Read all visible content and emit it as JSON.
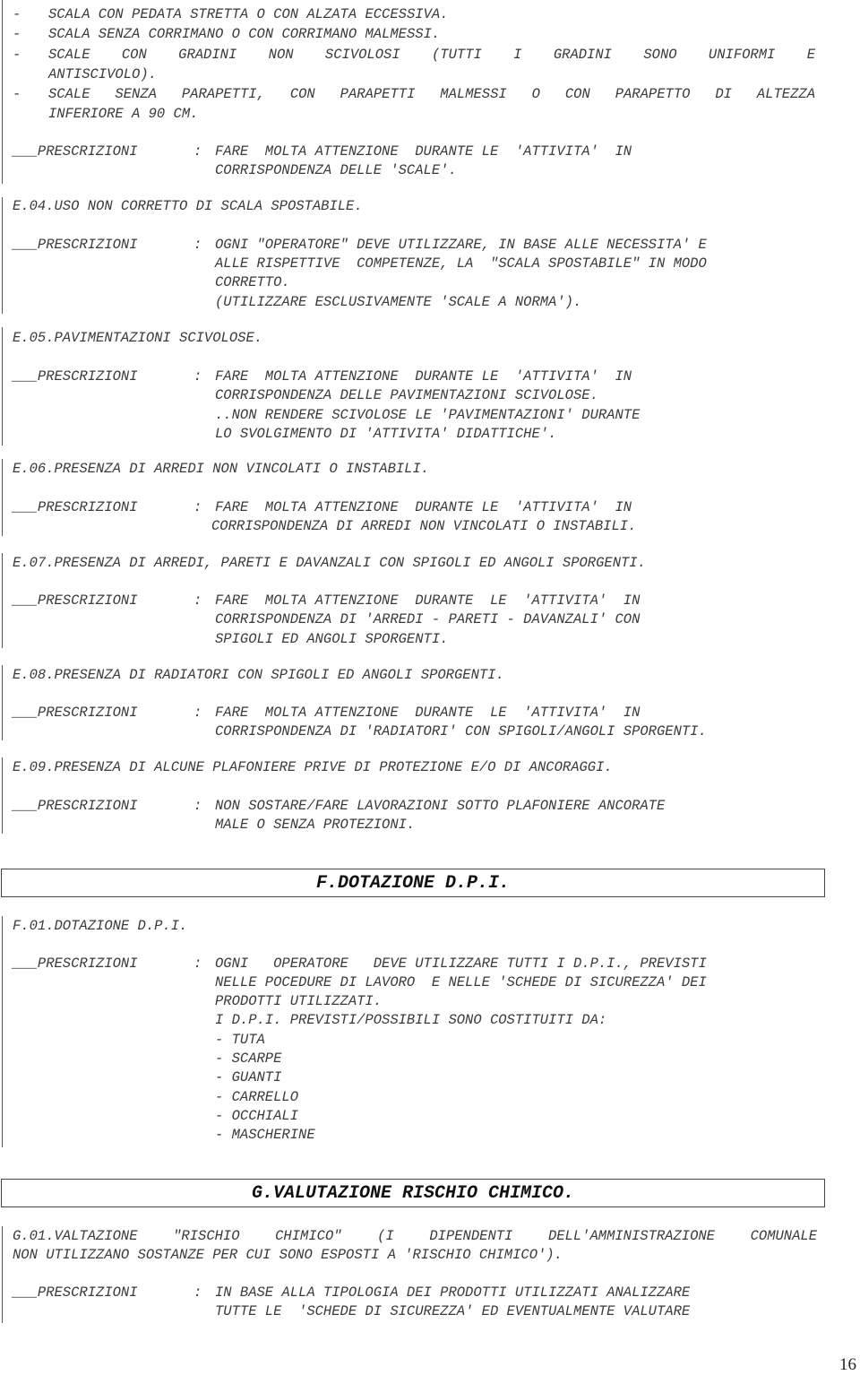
{
  "bullets_top": [
    {
      "dash": "-",
      "text": "SCALA CON PEDATA STRETTA O CON ALZATA ECCESSIVA."
    },
    {
      "dash": "-",
      "text": "SCALA SENZA CORRIMANO O CON CORRIMANO MALMESSI."
    },
    {
      "dash": "-",
      "text": "SCALE  CON  GRADINI  NON  SCIVOLOSI  (TUTTI  I  GRADINI  SONO  UNIFORMI  E",
      "cont": "ANTISCIVOLO)."
    },
    {
      "dash": "-",
      "text": "SCALE  SENZA  PARAPETTI,  CON  PARAPETTI  MALMESSI  O  CON  PARAPETTO  DI  ALTEZZA",
      "cont": "INFERIORE A 90 CM."
    }
  ],
  "presc_label": "___PRESCRIZIONI",
  "colon": ":",
  "blocks": {
    "e03_presc": [
      "FARE  MOLTA ATTENZIONE  DURANTE LE  'ATTIVITA'  IN",
      "CORRISPONDENZA DELLE 'SCALE'."
    ],
    "e04_title": "E.04.USO NON CORRETTO DI SCALA SPOSTABILE.",
    "e04_presc": [
      "OGNI \"OPERATORE\" DEVE UTILIZZARE, IN BASE ALLE NECESSITA' E",
      "ALLE RISPETTIVE  COMPETENZE, LA  \"SCALA SPOSTABILE\" IN MODO",
      "CORRETTO.",
      "(UTILIZZARE ESCLUSIVAMENTE 'SCALE A NORMA')."
    ],
    "e05_title": "E.05.PAVIMENTAZIONI SCIVOLOSE.",
    "e05_presc": [
      "FARE  MOLTA ATTENZIONE  DURANTE LE  'ATTIVITA'  IN",
      "CORRISPONDENZA DELLE PAVIMENTAZIONI SCIVOLOSE.",
      "..NON RENDERE SCIVOLOSE LE 'PAVIMENTAZIONI' DURANTE",
      "LO SVOLGIMENTO DI 'ATTIVITA' DIDATTICHE'."
    ],
    "e06_title": "E.06.PRESENZA DI ARREDI NON VINCOLATI O INSTABILI.",
    "e06_presc": [
      "FARE  MOLTA ATTENZIONE  DURANTE LE  'ATTIVITA'  IN",
      "CORRISPONDENZA DI ARREDI NON VINCOLATI O INSTABILI."
    ],
    "e07_title": "E.07.PRESENZA DI ARREDI, PARETI E DAVANZALI CON SPIGOLI ED ANGOLI SPORGENTI.",
    "e07_presc": [
      "FARE  MOLTA ATTENZIONE  DURANTE  LE  'ATTIVITA'  IN",
      "CORRISPONDENZA DI 'ARREDI - PARETI - DAVANZALI' CON",
      "SPIGOLI ED ANGOLI SPORGENTI."
    ],
    "e08_title": "E.08.PRESENZA DI RADIATORI CON SPIGOLI ED ANGOLI SPORGENTI.",
    "e08_presc": [
      "FARE  MOLTA ATTENZIONE  DURANTE  LE  'ATTIVITA'  IN",
      "CORRISPONDENZA DI 'RADIATORI' CON SPIGOLI/ANGOLI SPORGENTI."
    ],
    "e09_title": "E.09.PRESENZA DI ALCUNE PLAFONIERE PRIVE DI PROTEZIONE E/O DI ANCORAGGI.",
    "e09_presc": [
      "NON SOSTARE/FARE LAVORAZIONI SOTTO PLAFONIERE ANCORATE",
      "MALE O SENZA PROTEZIONI."
    ],
    "f_header": "F.DOTAZIONE D.P.I.",
    "f01_title": "F.01.DOTAZIONE D.P.I.",
    "f01_presc": [
      "OGNI   OPERATORE   DEVE UTILIZZARE TUTTI I D.P.I., PREVISTI",
      "NELLE POCEDURE DI LAVORO  E NELLE 'SCHEDE DI SICUREZZA' DEI",
      "PRODOTTI UTILIZZATI.",
      "I D.P.I. PREVISTI/POSSIBILI SONO COSTITUITI DA:",
      "- TUTA",
      "- SCARPE",
      "- GUANTI",
      "- CARRELLO",
      "- OCCHIALI",
      "- MASCHERINE"
    ],
    "g_header": "G.VALUTAZIONE RISCHIO CHIMICO.",
    "g01_title": [
      "G.01.VALTAZIONE  \"RISCHIO  CHIMICO\"  (I  DIPENDENTI  DELL'AMMINISTRAZIONE  COMUNALE",
      "NON UTILIZZANO SOSTANZE PER CUI SONO ESPOSTI A 'RISCHIO CHIMICO')."
    ],
    "g01_presc": [
      "IN BASE ALLA TIPOLOGIA DEI PRODOTTI UTILIZZATI ANALIZZARE",
      "TUTTE LE  'SCHEDE DI SICUREZZA' ED EVENTUALMENTE VALUTARE"
    ]
  },
  "page_number": "16"
}
